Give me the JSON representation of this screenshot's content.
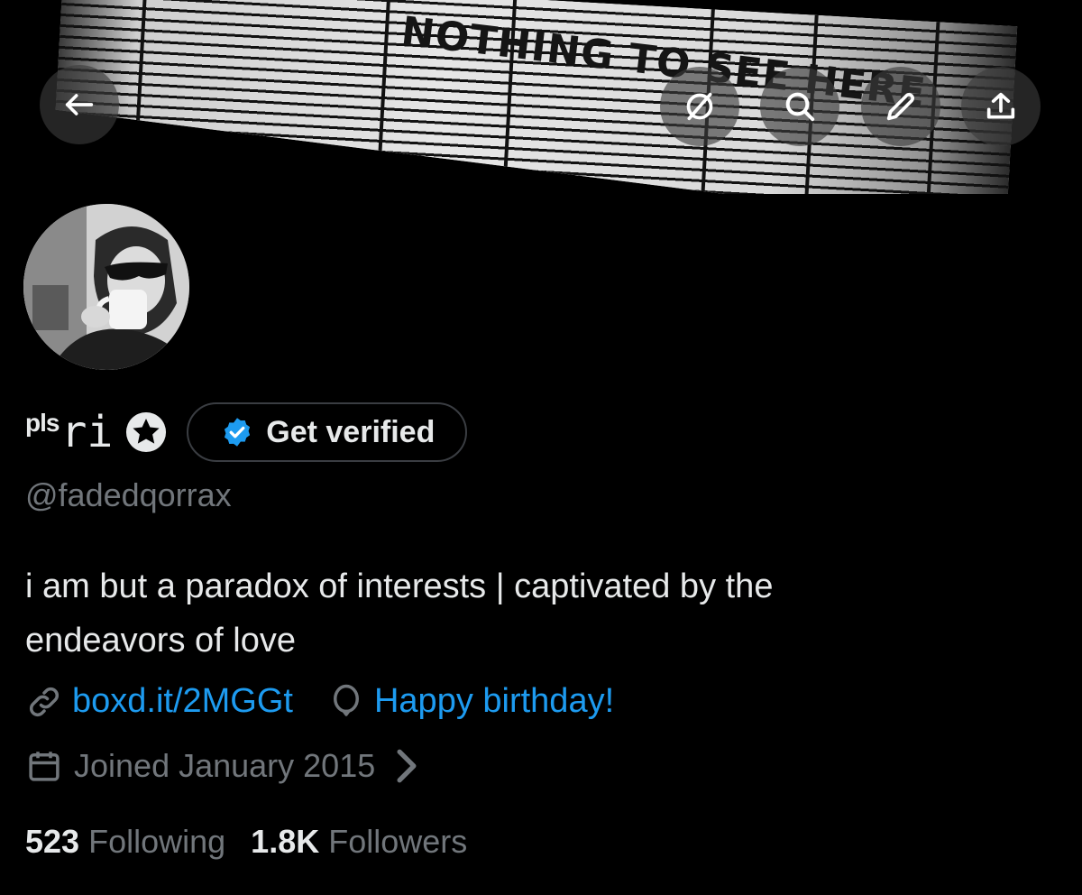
{
  "banner": {
    "sign_text": "NOTHING TO SEE HERE"
  },
  "header_icons": {
    "back": "arrow-left-icon",
    "grok": "slashed-circle-icon",
    "search": "search-icon",
    "edit": "pencil-icon",
    "share": "share-icon"
  },
  "profile": {
    "name_prefix": "pls",
    "name_main": "ri",
    "verify_button_label": "Get verified",
    "handle": "@fadedqorrax",
    "bio_line1": "i am but a paradox of interests | captivated by the",
    "bio_line2": "endeavors of love",
    "website": "boxd.it/2MGGt",
    "birthday": "Happy birthday!",
    "joined": "Joined January 2015",
    "following_count": "523",
    "following_label": "Following",
    "followers_count": "1.8K",
    "followers_label": "Followers"
  },
  "colors": {
    "background": "#000000",
    "text_primary": "#e7e9ea",
    "text_secondary": "#71767b",
    "link": "#1d9bf0",
    "verified_blue": "#1d9bf0"
  }
}
